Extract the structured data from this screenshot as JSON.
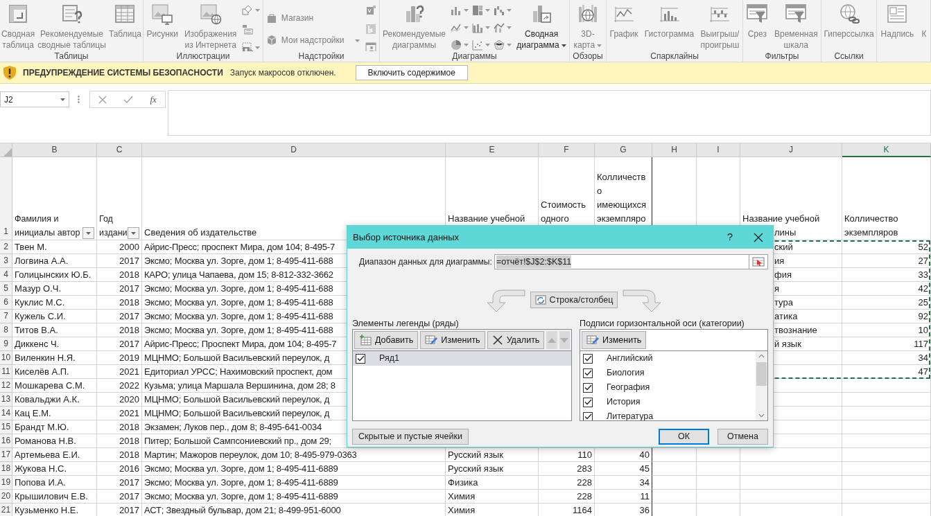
{
  "ribbon": {
    "groups": [
      {
        "label": "Таблицы",
        "items": [
          {
            "kind": "large",
            "label": "Сводная\nтаблица",
            "disabled": true
          },
          {
            "kind": "large",
            "label": "Рекомендуемые\nсводные таблицы",
            "disabled": true
          },
          {
            "kind": "large",
            "label": "Таблица",
            "disabled": true
          }
        ]
      },
      {
        "label": "Иллюстрации",
        "items": [
          {
            "kind": "large",
            "label": "Рисунки",
            "disabled": true
          },
          {
            "kind": "large",
            "label": "Изображения\nиз Интернета",
            "disabled": true
          },
          {
            "kind": "small_icons"
          }
        ]
      },
      {
        "label": "Надстройки",
        "items": [
          {
            "kind": "small_stack",
            "entries": [
              {
                "label": "Магазин",
                "disabled": true,
                "dropdown": false
              },
              {
                "label": "Мои надстройки",
                "disabled": true,
                "dropdown": true
              }
            ]
          },
          {
            "kind": "small_icons"
          }
        ]
      },
      {
        "label": "Диаграммы",
        "items": [
          {
            "kind": "large",
            "label": "Рекомендуемые\nдиаграммы",
            "disabled": true
          },
          {
            "kind": "chart_grid"
          },
          {
            "kind": "large",
            "label": "Сводная\nдиаграмма",
            "disabled": false,
            "dropdown": true
          }
        ]
      },
      {
        "label": "Обзоры",
        "items": [
          {
            "kind": "large",
            "label": "3D-\nкарта",
            "disabled": true,
            "dropdown": true
          }
        ]
      },
      {
        "label": "Спарклайны",
        "items": [
          {
            "kind": "large",
            "label": "График",
            "disabled": true
          },
          {
            "kind": "large",
            "label": "Гистограмма",
            "disabled": true
          },
          {
            "kind": "large",
            "label": "Выигрыш/\nпроигрыш",
            "disabled": true
          }
        ]
      },
      {
        "label": "Фильтры",
        "items": [
          {
            "kind": "large",
            "label": "Срез",
            "disabled": true
          },
          {
            "kind": "large",
            "label": "Временная\nшкала",
            "disabled": true
          }
        ]
      },
      {
        "label": "Ссылки",
        "items": [
          {
            "kind": "large",
            "label": "Гиперссылка",
            "disabled": true
          }
        ]
      },
      {
        "items": [
          {
            "kind": "large",
            "label": "Надпись",
            "disabled": true
          },
          {
            "kind": "large",
            "label": "К",
            "disabled": true
          }
        ]
      }
    ]
  },
  "security_bar": {
    "title": "ПРЕДУПРЕЖДЕНИЕ СИСТЕМЫ БЕЗОПАСНОСТИ",
    "message": "Запуск макросов отключен.",
    "button": "Включить содержимое"
  },
  "formula_bar": {
    "name_box": "J2",
    "fx": "fx"
  },
  "sheet": {
    "copy_marquee": true,
    "columns": [
      {
        "label": "B",
        "selected": false
      },
      {
        "label": "C",
        "selected": false
      },
      {
        "label": "D",
        "selected": false
      },
      {
        "label": "E",
        "selected": false
      },
      {
        "label": "F",
        "selected": false
      },
      {
        "label": "G",
        "selected": false
      },
      {
        "label": "H",
        "selected": false
      },
      {
        "label": "I",
        "selected": false
      },
      {
        "label": "J",
        "selected": false
      },
      {
        "label": "K",
        "selected": true
      }
    ],
    "header_row": {
      "number": "1",
      "cells": {
        "B": {
          "text": "Фамилия и\nинициалы автор",
          "filter": true
        },
        "C": {
          "text": "Год\nиздани",
          "filter": true
        },
        "D": {
          "text": "Сведения об издательстве",
          "filter": false
        },
        "E": {
          "text": "Название учебной",
          "filter": false
        },
        "F": {
          "text": "Стоимость\nодного",
          "filter": false
        },
        "G": {
          "text": "Колличеств\nо\nимеющихся\nэкземпляро",
          "filter": false
        },
        "J": {
          "text": "Название учебной",
          "continued": "лины",
          "filter": false
        },
        "K": {
          "text": "Колличество\nэкземпляров",
          "filter": false
        }
      }
    },
    "rows": [
      {
        "number": "2",
        "cells": {
          "B": "Твен М.",
          "C": "2000",
          "D": "Айрис-Пресс; проспект Мира, дом 104; 8-495-7",
          "J": "ский",
          "K": "52"
        }
      },
      {
        "number": "3",
        "cells": {
          "B": "Логвина А.А.",
          "C": "2017",
          "D": "Эксмо; Москва ул. Зорге, дом 1; 8-495-411-688",
          "J": "ия",
          "K": "27"
        }
      },
      {
        "number": "4",
        "cells": {
          "B": "Голицынских Ю.Б.",
          "C": "2018",
          "D": "КАРО; улица Чапаева, дом 15; 8-812-332-3662",
          "J": "фия",
          "K": "33"
        }
      },
      {
        "number": "5",
        "cells": {
          "B": "Мазур О.Ч.",
          "C": "2017",
          "D": "Эксмо; Москва ул. Зорге, дом 1; 8-495-411-688",
          "J": "я",
          "K": "42"
        }
      },
      {
        "number": "6",
        "cells": {
          "B": "Куклис М.С.",
          "C": "2018",
          "D": "Эксмо; Москва ул. Зорге, дом 1; 8-495-411-688",
          "J": "тура",
          "K": "25"
        }
      },
      {
        "number": "7",
        "cells": {
          "B": "Кужель С.И.",
          "C": "2017",
          "D": "Эксмо; Москва ул. Зорге, дом 1; 8-495-411-688",
          "J": "атика",
          "K": "92"
        }
      },
      {
        "number": "8",
        "cells": {
          "B": "Титов В.А.",
          "C": "2018",
          "D": "Эксмо; Москва ул. Зорге, дом 1; 8-495-411-688",
          "J": "твознание",
          "K": "10"
        }
      },
      {
        "number": "9",
        "cells": {
          "B": "Диккенс Ч.",
          "C": "2017",
          "D": "Айрис-Пресс; Проспект Мира, дом 104; 8-495-7",
          "J": "й язык",
          "K": "117"
        }
      },
      {
        "number": "10",
        "cells": {
          "B": "Виленкин Н.Я.",
          "C": "2019",
          "D": "МЦНМО; Большой Васильевский переулок, д",
          "K": "34"
        }
      },
      {
        "number": "11",
        "cells": {
          "B": "Киселёв А.П.",
          "C": "2021",
          "D": "Едиториал УРСС; Нахимовский проспект, дом",
          "K": "47"
        }
      },
      {
        "number": "12",
        "cells": {
          "B": "Мошкарева С.М.",
          "C": "2022",
          "D": "Кузьма; улица Маршала Вершинина, дом 28; 8"
        }
      },
      {
        "number": "13",
        "cells": {
          "B": "Ковальджи А.К.",
          "C": "2020",
          "D": "МЦНМО; Большой Васильевский переулок, д"
        }
      },
      {
        "number": "14",
        "cells": {
          "B": "Кац Е.М.",
          "C": "2021",
          "D": "МЦНМО; Большой Васильевский переулок, д"
        }
      },
      {
        "number": "15",
        "cells": {
          "B": "Брандт М.Ю.",
          "C": "2018",
          "D": "Экзамен; Луков пер., дом 8; 8-495-641-0034"
        }
      },
      {
        "number": "16",
        "cells": {
          "B": "Романова Н.В.",
          "C": "2018",
          "D": "Питер; Большой Сампсониевский пр., дом 29;"
        }
      },
      {
        "number": "17",
        "cells": {
          "B": "Артемьева Е.И.",
          "C": "2018",
          "D": "Мартин; Мажоров переулок, дом 10; 8-495-979-0363",
          "E": "Русский язык",
          "F": "110",
          "G": "40"
        }
      },
      {
        "number": "18",
        "cells": {
          "B": "Жукова Н.С.",
          "C": "2016",
          "D": "Эксмо; Москва ул. Зорге, дом 1; 8-495-411-6889",
          "E": "Русский язык",
          "F": "283",
          "G": "45"
        }
      },
      {
        "number": "19",
        "cells": {
          "B": "Попова И.А.",
          "C": "2017",
          "D": "Эксмо; Москва ул. Зорге, дом 1; 8-495-411-6889",
          "E": "Физика",
          "F": "228",
          "G": "34"
        }
      },
      {
        "number": "20",
        "cells": {
          "B": "Крышилович Е.В.",
          "C": "2017",
          "D": "Эксмо; Москва ул. Зорге, дом 1; 8-495-411-6889",
          "E": "Химия",
          "F": "228",
          "G": "11"
        }
      },
      {
        "number": "21",
        "cells": {
          "B": "Кузьменко Н.Е.",
          "C": "2017",
          "D": "АСТ; Звездный бульвар, дом 21; 8-499-951-6000",
          "E": "Химия",
          "F": "1164",
          "G": "36"
        }
      }
    ]
  },
  "dialog": {
    "title": "Выбор источника данных",
    "help": "?",
    "range_label": "Диапазон данных для диаграммы:",
    "range_value": "=отчёт!$J$2:$K$11",
    "switch_button": "Строка/столбец",
    "series": {
      "label": "Элементы легенды (ряды)",
      "buttons": [
        {
          "kind": "add",
          "label": "Добавить",
          "disabled": false
        },
        {
          "kind": "edit",
          "label": "Изменить",
          "disabled": false
        },
        {
          "kind": "delete",
          "label": "Удалить",
          "disabled": false
        },
        {
          "kind": "up",
          "disabled": true
        },
        {
          "kind": "down",
          "disabled": true
        }
      ],
      "items": [
        {
          "label": "Ряд1",
          "checked": true,
          "selected": true
        }
      ]
    },
    "categories": {
      "label": "Подписи горизонтальной оси (категории)",
      "buttons": [
        {
          "kind": "edit",
          "label": "Изменить",
          "disabled": false
        }
      ],
      "items": [
        {
          "label": "Английский",
          "checked": true,
          "selected": false
        },
        {
          "label": "Биология",
          "checked": true,
          "selected": false
        },
        {
          "label": "География",
          "checked": true,
          "selected": false
        },
        {
          "label": "История",
          "checked": true,
          "selected": false
        },
        {
          "label": "Литература",
          "checked": true,
          "selected": false
        }
      ]
    },
    "hidden_cells_button": "Скрытые и пустые ячейки",
    "ok_button": "ОК",
    "cancel_button": "Отмена"
  }
}
